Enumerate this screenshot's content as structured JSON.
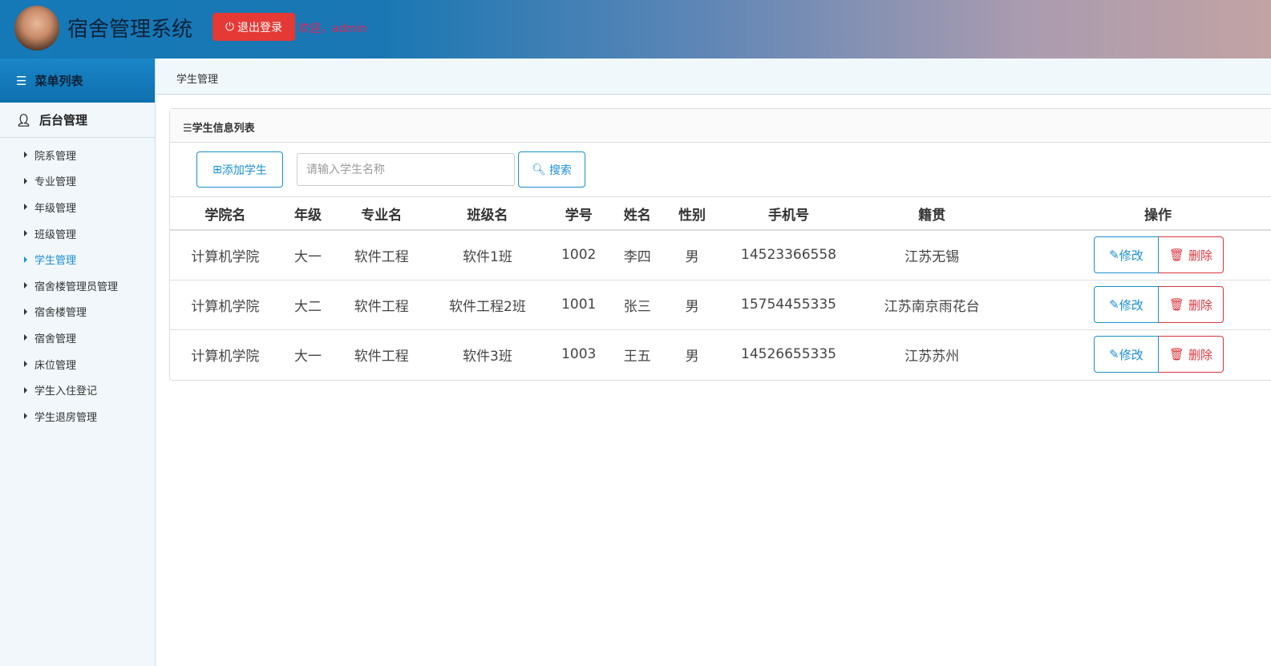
{
  "header": {
    "title": "宿舍管理系统",
    "logout_label": "退出登录",
    "welcome": "欢迎，admin"
  },
  "sidebar": {
    "menu_title": "菜单列表",
    "group": "后台管理",
    "items": [
      {
        "label": "院系管理"
      },
      {
        "label": "专业管理"
      },
      {
        "label": "年级管理"
      },
      {
        "label": "班级管理"
      },
      {
        "label": "学生管理",
        "active": true
      },
      {
        "label": "宿舍楼管理员管理"
      },
      {
        "label": "宿舍楼管理"
      },
      {
        "label": "宿舍管理"
      },
      {
        "label": "床位管理"
      },
      {
        "label": "学生入住登记"
      },
      {
        "label": "学生退房管理"
      }
    ]
  },
  "breadcrumb": "学生管理",
  "panel": {
    "title": "☰学生信息列表",
    "add_label": "添加学生",
    "search_placeholder": "请输入学生名称",
    "search_label": "搜索"
  },
  "table": {
    "headers": [
      "学院名",
      "年级",
      "专业名",
      "班级名",
      "学号",
      "姓名",
      "性别",
      "手机号",
      "籍贯",
      "操作"
    ],
    "rows": [
      [
        "计算机学院",
        "大一",
        "软件工程",
        "软件1班",
        "1002",
        "李四",
        "男",
        "14523366558",
        "江苏无锡"
      ],
      [
        "计算机学院",
        "大二",
        "软件工程",
        "软件工程2班",
        "1001",
        "张三",
        "男",
        "15754455335",
        "江苏南京雨花台"
      ],
      [
        "计算机学院",
        "大一",
        "软件工程",
        "软件3班",
        "1003",
        "王五",
        "男",
        "14526655335",
        "江苏苏州"
      ]
    ],
    "edit_label": "修改",
    "delete_label": "删除"
  }
}
